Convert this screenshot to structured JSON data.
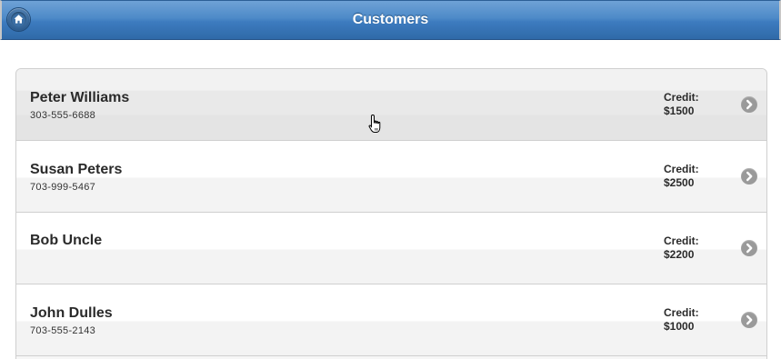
{
  "header": {
    "title": "Customers",
    "home_icon": "home-icon"
  },
  "customers": [
    {
      "name": "Peter Williams",
      "phone": "303-555-6688",
      "credit_label": "Credit:",
      "credit": "$1500"
    },
    {
      "name": "Susan Peters",
      "phone": "703-999-5467",
      "credit_label": "Credit:",
      "credit": "$2500"
    },
    {
      "name": "Bob Uncle",
      "phone": "",
      "credit_label": "Credit:",
      "credit": "$2200"
    },
    {
      "name": "John Dulles",
      "phone": "703-555-2143",
      "credit_label": "Credit:",
      "credit": "$1000"
    }
  ],
  "icons": {
    "row_arrow": "chevron-right-icon",
    "pointer": "hand-pointer-icon"
  },
  "colors": {
    "header_blue": "#4d8ac8",
    "arrow_gray": "#9a9a9a"
  }
}
